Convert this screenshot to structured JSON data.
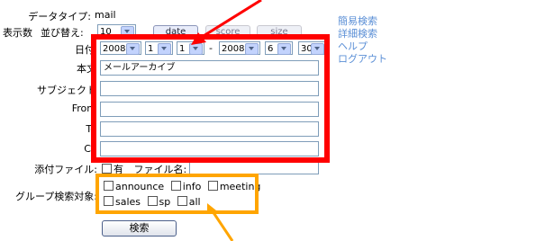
{
  "data_type": {
    "label": "データタイプ:",
    "value": "mail"
  },
  "display": {
    "count_label": "表示数",
    "count_value": "10",
    "sort_label": "並び替え:"
  },
  "sort_tabs": [
    {
      "label": "date",
      "active": true
    },
    {
      "label": "score",
      "active": false
    },
    {
      "label": "size",
      "active": false
    }
  ],
  "side_links": [
    "簡易検索",
    "詳細検索",
    "ヘルプ",
    "ログアウト"
  ],
  "date": {
    "label": "日付",
    "from_year": "2008",
    "from_month": "1",
    "from_day": "1",
    "separator": "-",
    "to_year": "2008",
    "to_month": "6",
    "to_day": "30"
  },
  "fields": {
    "body": {
      "label": "本文",
      "value": "メールアーカイブ"
    },
    "subject": {
      "label": "サブジェクト",
      "value": ""
    },
    "from": {
      "label": "From",
      "value": ""
    },
    "to": {
      "label": "To",
      "value": ""
    },
    "cc": {
      "label": "Cc",
      "value": ""
    }
  },
  "attachment": {
    "label": "添付ファイル:",
    "has_label": "有",
    "filename_label": "ファイル名:",
    "filename_value": ""
  },
  "group": {
    "label": "グループ検索対象:",
    "options": [
      "announce",
      "info",
      "meeting",
      "sales",
      "sp",
      "all"
    ]
  },
  "search_button": "検索",
  "colors": {
    "red_highlight": "#ff0000",
    "orange_highlight": "#ffa500",
    "link": "#5b8fd6"
  }
}
